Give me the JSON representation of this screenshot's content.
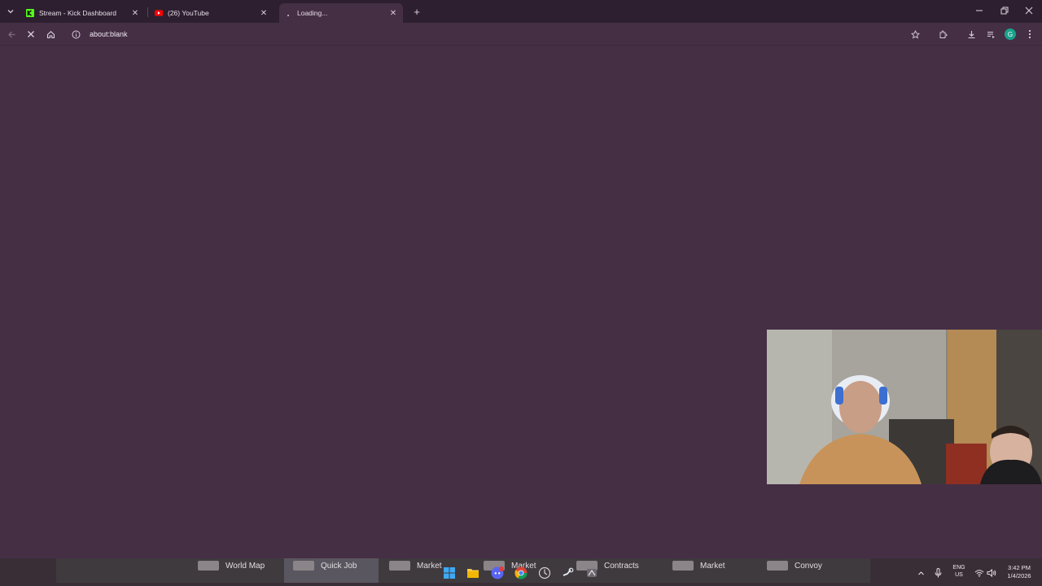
{
  "browser": {
    "tabs": [
      {
        "title": "Stream - Kick Dashboard",
        "favicon": "kick-icon",
        "active": false
      },
      {
        "title": "(26) YouTube",
        "favicon": "youtube-icon",
        "active": false
      },
      {
        "title": "Loading...",
        "favicon": "loading-spinner-icon",
        "active": true
      }
    ],
    "address": "about:blank",
    "profile_initial": "G",
    "accent_color": "#452f45"
  },
  "game_hud": {
    "items": [
      {
        "label": "World Map",
        "icon": "map-icon"
      },
      {
        "label": "Quick Job",
        "icon": "quick-job-icon"
      },
      {
        "label": "Market",
        "icon": "market-icon"
      },
      {
        "label": "Market",
        "icon": "market-icon"
      },
      {
        "label": "Contracts",
        "icon": "contracts-icon"
      },
      {
        "label": "Market",
        "icon": "market-icon"
      },
      {
        "label": "Convoy",
        "icon": "convoy-icon"
      }
    ]
  },
  "taskbar": {
    "apps": [
      "windows-start-icon",
      "file-explorer-icon",
      "discord-icon",
      "chrome-icon",
      "app-icon",
      "steam-icon",
      "game-icon"
    ],
    "language": "ENG",
    "region": "US",
    "time": "3:42 PM",
    "date": "1/4/2026"
  }
}
